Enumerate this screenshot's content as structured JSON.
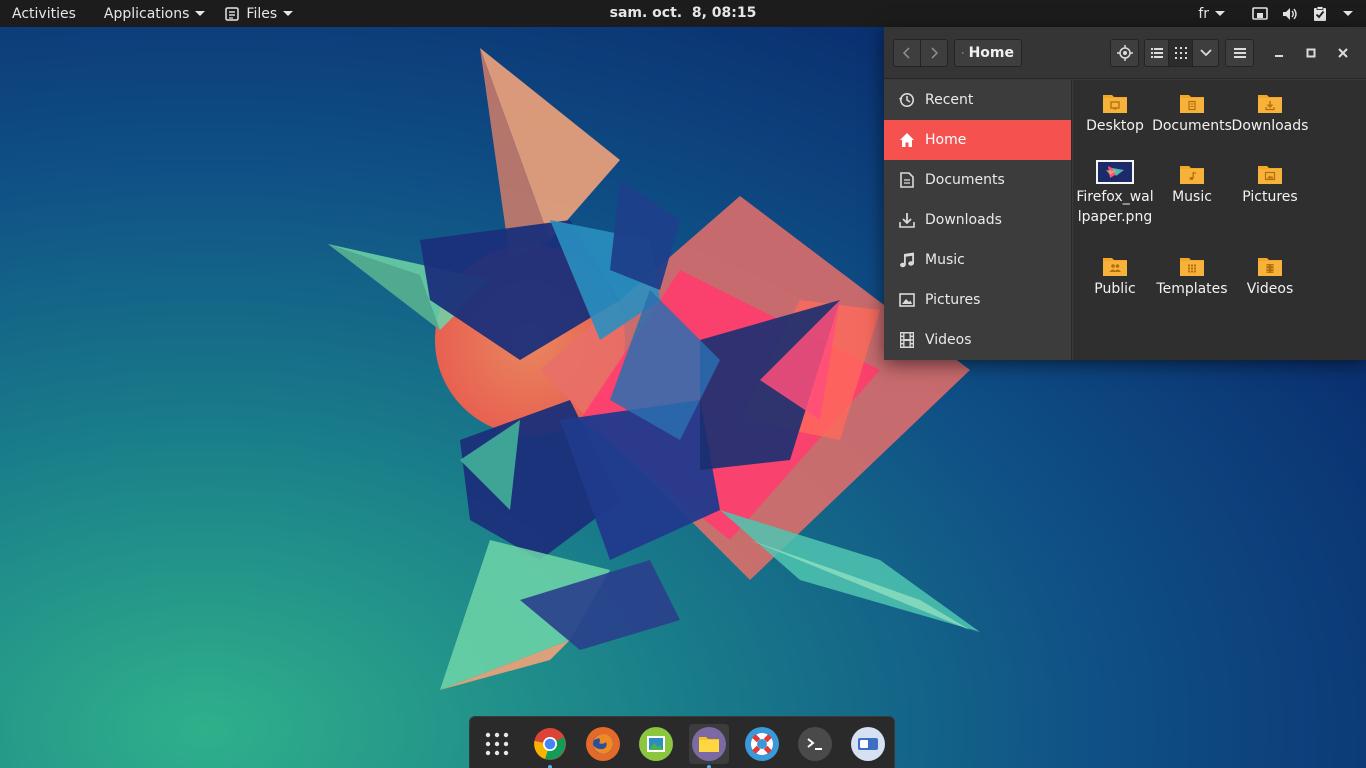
{
  "topbar": {
    "activities": "Activities",
    "applications": "Applications",
    "files_menu": "Files",
    "clock": "sam. oct.  8, 08:15",
    "keyboard_layout": "fr"
  },
  "file_manager": {
    "path_label": "Home",
    "sidebar": [
      {
        "label": "Recent",
        "icon": "clock-icon",
        "active": false
      },
      {
        "label": "Home",
        "icon": "home-icon",
        "active": true
      },
      {
        "label": "Documents",
        "icon": "document-icon",
        "active": false
      },
      {
        "label": "Downloads",
        "icon": "download-icon",
        "active": false
      },
      {
        "label": "Music",
        "icon": "music-icon",
        "active": false
      },
      {
        "label": "Pictures",
        "icon": "picture-icon",
        "active": false
      },
      {
        "label": "Videos",
        "icon": "film-icon",
        "active": false
      }
    ],
    "files": [
      {
        "name": "Desktop",
        "icon": "folder-desktop-icon"
      },
      {
        "name": "Documents",
        "icon": "folder-documents-icon"
      },
      {
        "name": "Downloads",
        "icon": "folder-downloads-icon"
      },
      {
        "name": "Firefox_wallpaper.png",
        "icon": "image-thumbnail-icon"
      },
      {
        "name": "Music",
        "icon": "folder-music-icon"
      },
      {
        "name": "Pictures",
        "icon": "folder-pictures-icon"
      },
      {
        "name": "Public",
        "icon": "folder-public-icon"
      },
      {
        "name": "Templates",
        "icon": "folder-templates-icon"
      },
      {
        "name": "Videos",
        "icon": "folder-videos-icon"
      }
    ]
  },
  "dock": [
    {
      "name": "show-apps",
      "icon": "grid-icon"
    },
    {
      "name": "chrome",
      "icon": "chrome-icon"
    },
    {
      "name": "firefox",
      "icon": "firefox-icon"
    },
    {
      "name": "image-viewer",
      "icon": "image-viewer-icon"
    },
    {
      "name": "files",
      "icon": "files-icon"
    },
    {
      "name": "help",
      "icon": "lifebuoy-icon"
    },
    {
      "name": "terminal",
      "icon": "terminal-icon"
    },
    {
      "name": "settings",
      "icon": "toggle-icon"
    }
  ],
  "colors": {
    "accent": "#f5524f",
    "folder": "#f5a623",
    "panel": "#1c1c1c"
  }
}
